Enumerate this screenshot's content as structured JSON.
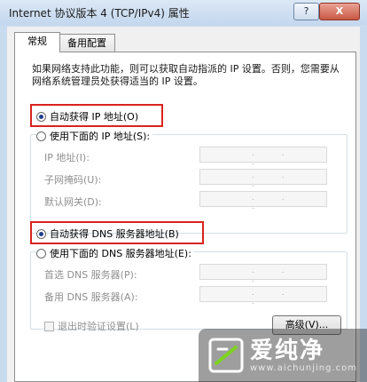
{
  "window": {
    "title": "Internet 协议版本 4 (TCP/IPv4) 属性",
    "help_label": "?",
    "close_label": "X"
  },
  "tabs": [
    {
      "label": "常规"
    },
    {
      "label": "备用配置"
    }
  ],
  "description": "如果网络支持此功能，则可以获取自动指派的 IP 设置。否则，您需要从网络系统管理员处获得适当的 IP 设置。",
  "ip": {
    "auto_label": "自动获得 IP 地址(O)",
    "manual_label": "使用下面的 IP 地址(S):",
    "fields": [
      {
        "label": "IP 地址(I):",
        "value": ". . ."
      },
      {
        "label": "子网掩码(U):",
        "value": ". . ."
      },
      {
        "label": "默认网关(D):",
        "value": ". . ."
      }
    ]
  },
  "dns": {
    "auto_label": "自动获得 DNS 服务器地址(B)",
    "manual_label": "使用下面的 DNS 服务器地址(E):",
    "fields": [
      {
        "label": "首选 DNS 服务器(P):",
        "value": ". . ."
      },
      {
        "label": "备用 DNS 服务器(A):",
        "value": ". . ."
      }
    ]
  },
  "validate_label": "退出时验证设置(L)",
  "advanced_label": "高级(V)...",
  "watermark": {
    "name": "爱纯净",
    "url": "www.aichunjing.com"
  },
  "colors": {
    "highlight_box": "#d9231c",
    "title_bar": "#c4d7ee"
  }
}
